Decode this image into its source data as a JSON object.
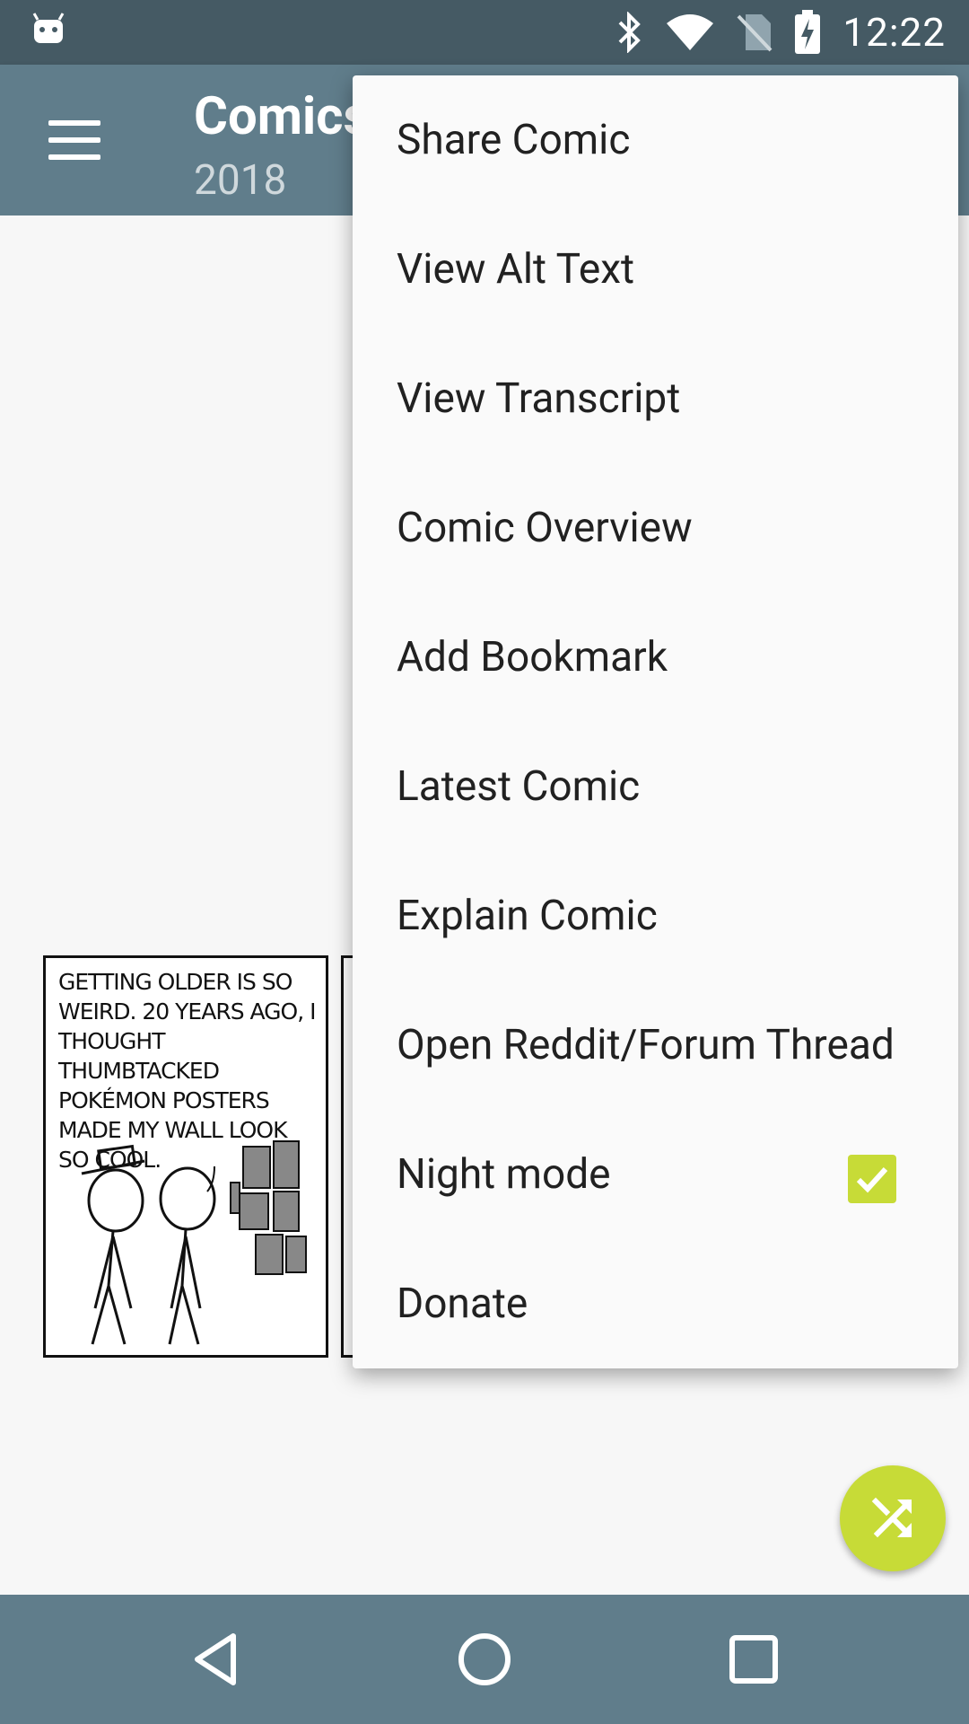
{
  "status_bar": {
    "time": "12:22",
    "icons": [
      "android-debug-icon",
      "bluetooth-icon",
      "wifi-icon",
      "no-sim-icon",
      "battery-charging-icon"
    ]
  },
  "app_bar": {
    "title": "Comics",
    "subtitle": "2018",
    "menu_icon": "hamburger-icon"
  },
  "comic": {
    "text": "Getting older is so weird. 20 years ago, I thought thumbtacked Pokémon posters made my wall look so cool."
  },
  "menu": {
    "items": [
      {
        "label": "Share Comic"
      },
      {
        "label": "View Alt Text"
      },
      {
        "label": "View Transcript"
      },
      {
        "label": "Comic Overview"
      },
      {
        "label": "Add Bookmark"
      },
      {
        "label": "Latest Comic"
      },
      {
        "label": "Explain Comic"
      },
      {
        "label": "Open Reddit/Forum Thread"
      },
      {
        "label": "Night mode",
        "checked": true
      },
      {
        "label": "Donate"
      }
    ]
  },
  "fab": {
    "icon": "shuffle-icon"
  },
  "nav_bar": {
    "icons": [
      "back-icon",
      "home-icon",
      "recents-icon"
    ]
  },
  "colors": {
    "status_bar": "#455a64",
    "app_bar": "#607d8b",
    "accent": "#c7db37",
    "menu_bg": "#fafafa"
  }
}
